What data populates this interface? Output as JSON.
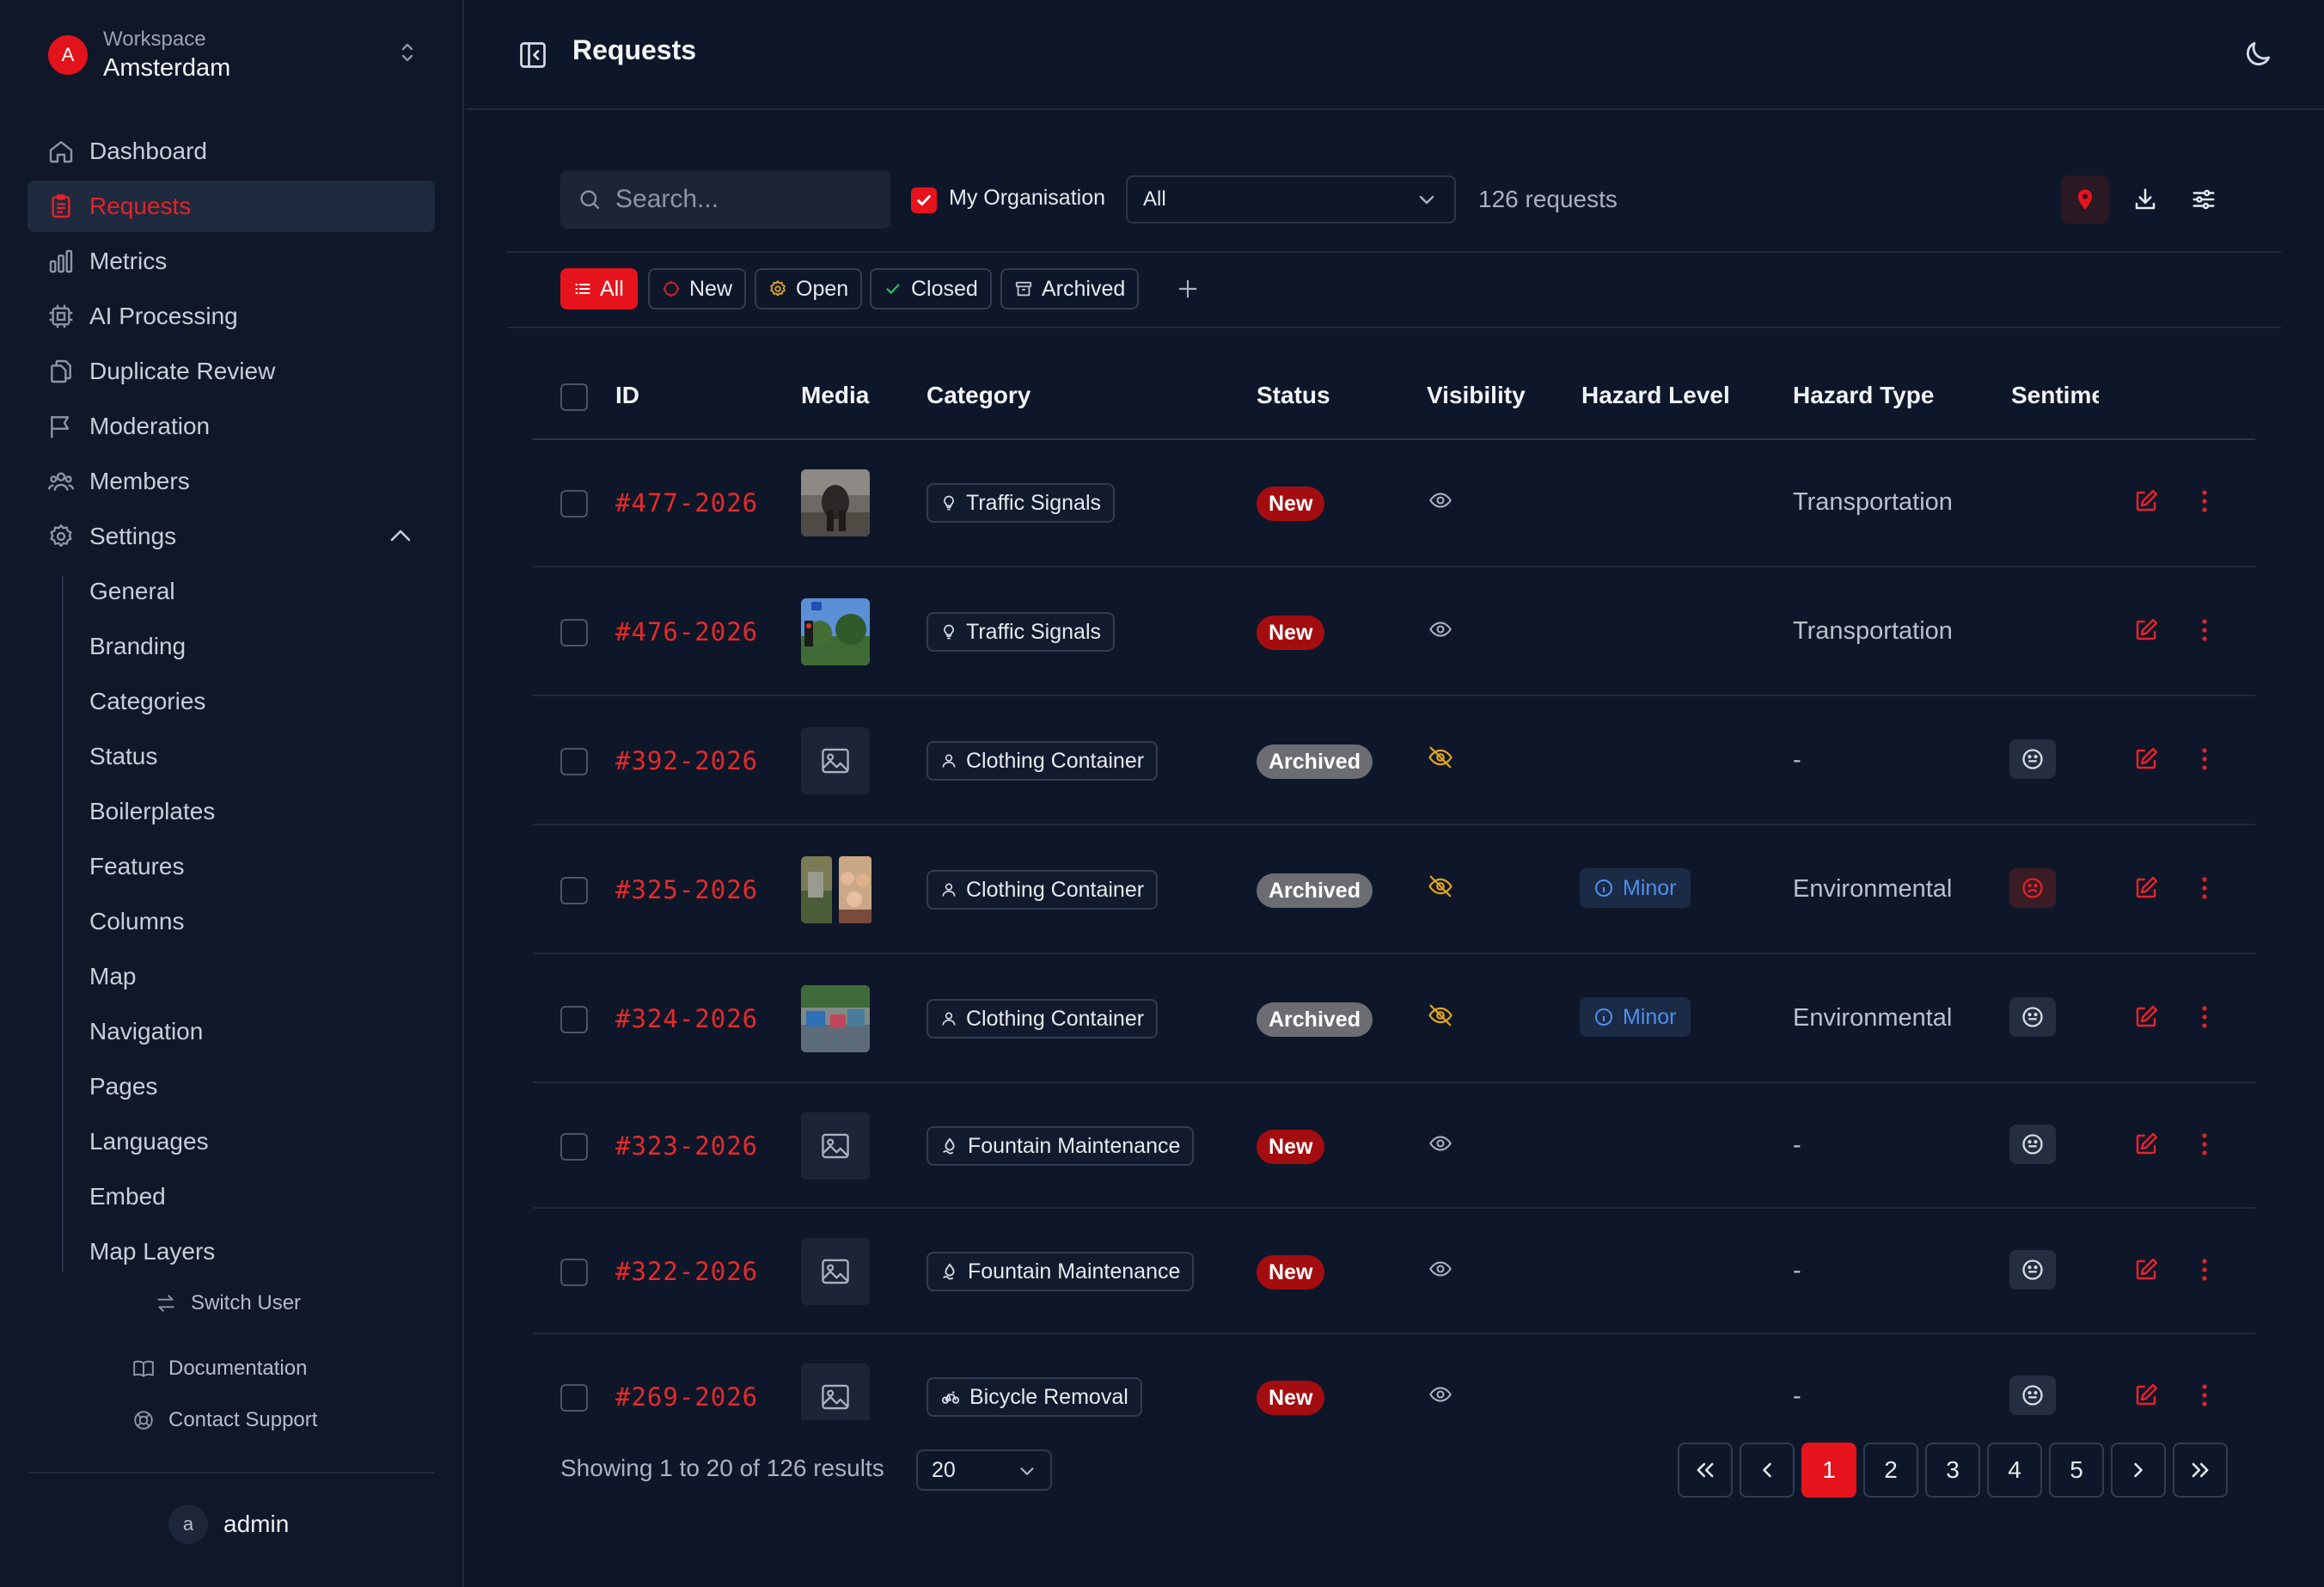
{
  "workspace": {
    "label": "Workspace",
    "name": "Amsterdam",
    "initial": "A"
  },
  "nav": [
    {
      "label": "Dashboard",
      "icon": "home-icon"
    },
    {
      "label": "Requests",
      "icon": "clipboard-icon",
      "active": true
    },
    {
      "label": "Metrics",
      "icon": "bar-chart-icon"
    },
    {
      "label": "AI Processing",
      "icon": "cpu-icon"
    },
    {
      "label": "Duplicate Review",
      "icon": "copy-icon"
    },
    {
      "label": "Moderation",
      "icon": "flag-icon"
    },
    {
      "label": "Members",
      "icon": "users-icon"
    },
    {
      "label": "Settings",
      "icon": "gear-icon"
    }
  ],
  "settings_sub": [
    "General",
    "Branding",
    "Categories",
    "Status",
    "Boilerplates",
    "Features",
    "Columns",
    "Map",
    "Navigation",
    "Pages",
    "Languages",
    "Embed",
    "Map Layers"
  ],
  "util": {
    "switch_user": "Switch User",
    "documentation": "Documentation",
    "contact_support": "Contact Support"
  },
  "user": {
    "initial": "a",
    "name": "admin"
  },
  "page": {
    "title": "Requests"
  },
  "toolbar": {
    "search_placeholder": "Search...",
    "org_label": "My Organisation",
    "org_checked": true,
    "org_select": "All",
    "count": "126 requests"
  },
  "chips": [
    {
      "label": "All",
      "icon": "list-icon",
      "active": true
    },
    {
      "label": "New",
      "icon": "new-status-icon"
    },
    {
      "label": "Open",
      "icon": "open-status-icon"
    },
    {
      "label": "Closed",
      "icon": "check-icon"
    },
    {
      "label": "Archived",
      "icon": "archive-icon"
    }
  ],
  "columns": [
    "ID",
    "Media",
    "Category",
    "Status",
    "Visibility",
    "Hazard Level",
    "Hazard Type",
    "Sentime"
  ],
  "rows": [
    {
      "id": "#477-2026",
      "media": "photo",
      "category": "Traffic Signals",
      "cat_icon": "bulb-icon",
      "status": "New",
      "visible": true,
      "hazard": "",
      "type": "Transportation",
      "sentiment": ""
    },
    {
      "id": "#476-2026",
      "media": "photo",
      "category": "Traffic Signals",
      "cat_icon": "bulb-icon",
      "status": "New",
      "visible": true,
      "hazard": "",
      "type": "Transportation",
      "sentiment": ""
    },
    {
      "id": "#392-2026",
      "media": "placeholder",
      "category": "Clothing Container",
      "cat_icon": "person-icon",
      "status": "Archived",
      "visible": false,
      "hazard": "",
      "type": "-",
      "sentiment": "neutral"
    },
    {
      "id": "#325-2026",
      "media": "two-photos",
      "category": "Clothing Container",
      "cat_icon": "person-icon",
      "status": "Archived",
      "visible": false,
      "hazard": "Minor",
      "type": "Environmental",
      "sentiment": "negative"
    },
    {
      "id": "#324-2026",
      "media": "photo",
      "category": "Clothing Container",
      "cat_icon": "person-icon",
      "status": "Archived",
      "visible": false,
      "hazard": "Minor",
      "type": "Environmental",
      "sentiment": "neutral"
    },
    {
      "id": "#323-2026",
      "media": "placeholder",
      "category": "Fountain Maintenance",
      "cat_icon": "fountain-icon",
      "status": "New",
      "visible": true,
      "hazard": "",
      "type": "-",
      "sentiment": "neutral"
    },
    {
      "id": "#322-2026",
      "media": "placeholder",
      "category": "Fountain Maintenance",
      "cat_icon": "fountain-icon",
      "status": "New",
      "visible": true,
      "hazard": "",
      "type": "-",
      "sentiment": "neutral"
    },
    {
      "id": "#269-2026",
      "media": "placeholder",
      "category": "Bicycle Removal",
      "cat_icon": "bicycle-icon",
      "status": "New",
      "visible": true,
      "hazard": "",
      "type": "-",
      "sentiment": "neutral"
    }
  ],
  "footer": {
    "showing": "Showing 1 to 20 of 126 results",
    "page_size": "20",
    "pages": [
      "1",
      "2",
      "3",
      "4",
      "5"
    ],
    "current_page": "1"
  },
  "colors": {
    "accent": "#e5141c",
    "background": "#0e1729",
    "archived": "#6b6d72",
    "hazard_blue": "#4d8ff0",
    "hidden_eye": "#e0a420"
  }
}
